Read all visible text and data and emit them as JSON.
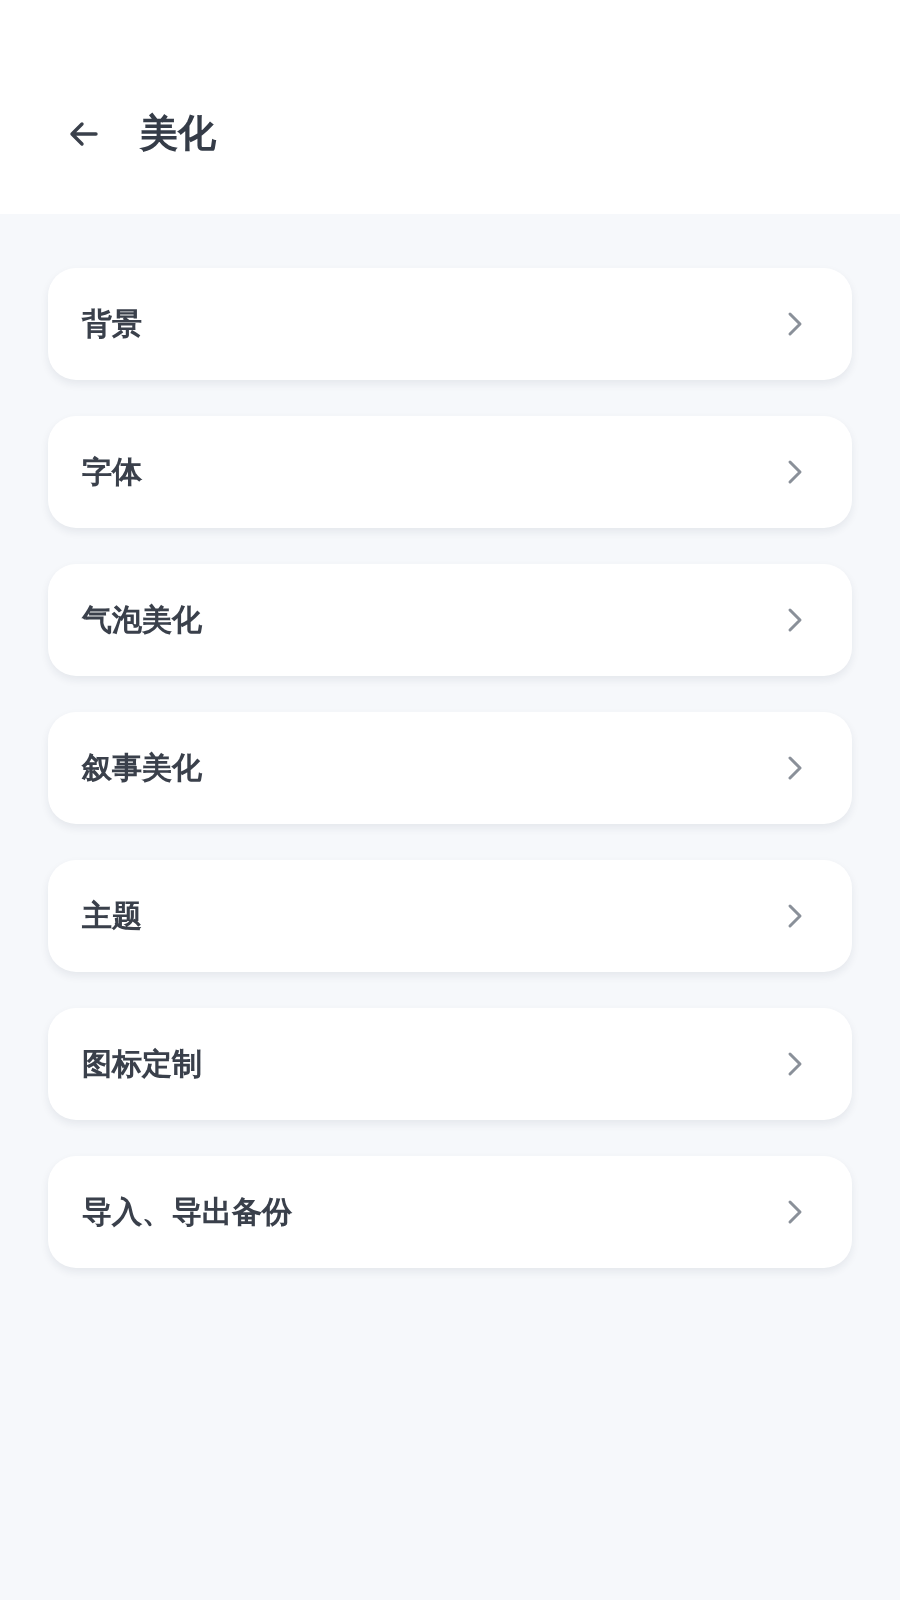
{
  "header": {
    "title": "美化"
  },
  "items": [
    {
      "label": "背景"
    },
    {
      "label": "字体"
    },
    {
      "label": "气泡美化"
    },
    {
      "label": "叙事美化"
    },
    {
      "label": "主题"
    },
    {
      "label": "图标定制"
    },
    {
      "label": "导入、导出备份"
    }
  ]
}
